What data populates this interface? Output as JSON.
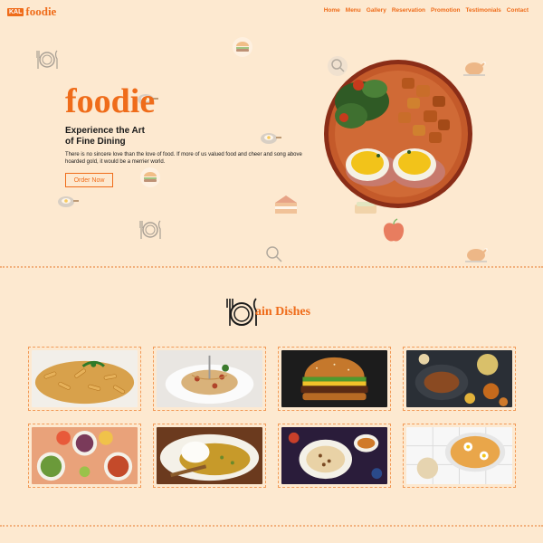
{
  "brand": {
    "badge": "KAL",
    "name": "foodie"
  },
  "nav": {
    "items": [
      "Home",
      "Menu",
      "Gallery",
      "Reservation",
      "Promotion",
      "Testimonials",
      "Contact"
    ]
  },
  "hero": {
    "title": "foodie",
    "subtitle_line1": "Experience the Art",
    "subtitle_line2": "of Fine Dining",
    "description": "There is no sincere love than the love of food. If more of us valued food and cheer and song above hoarded gold, it would be a merrier world.",
    "cta": "Order Now"
  },
  "section": {
    "title": "ain Dishes"
  },
  "colors": {
    "accent": "#ef6c1a",
    "background": "#fde9d0",
    "dashed_border": "#f29a57"
  },
  "icons": [
    "plate-fork-knife-icon",
    "burger-icon",
    "pan-egg-icon",
    "roast-chicken-icon",
    "cake-icon",
    "apple-icon",
    "rice-bowl-icon"
  ]
}
